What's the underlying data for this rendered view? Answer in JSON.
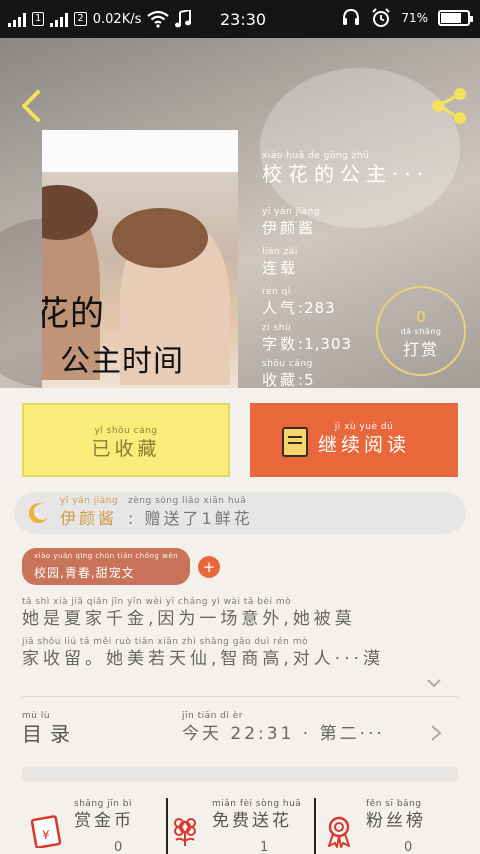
{
  "status_bar": {
    "sim1": "1",
    "sim2": "2",
    "speed": "0.02K/s",
    "time": "23:30",
    "battery": "71%",
    "battery_level": 0.71
  },
  "book": {
    "title_py": "xiào  huā   de  gōng  zhǔ",
    "title": "校花的公主···",
    "author_py": "yī  yán  jiàng",
    "author": "伊颜酱",
    "status_py": "lián  zài",
    "status": "连载",
    "popularity_py": "rén  qì",
    "popularity_label": "人气",
    "popularity_value": ":283",
    "words_py": "zì  shù",
    "words_label": "字数",
    "words_value": ":1,303",
    "favorites_py": "shōu  cáng",
    "favorites_label": "收藏",
    "favorites_value": ":5",
    "cover_title_line1": "校花的",
    "cover_title_line2": "公主时间"
  },
  "tip": {
    "count": "0",
    "label_py": "dǎ  shǎng",
    "label": "打赏"
  },
  "actions": {
    "fav_py": "yǐ   shōu  cáng",
    "fav_label": "已收藏",
    "read_py": "jì    xù    yuè   dú",
    "read_label": "继续阅读"
  },
  "gift": {
    "author_py": "yī  yán  jiàng",
    "author": "伊颜酱",
    "message_py": "zèng sòng  liǎo   xiān  huā",
    "message": ": 赠送了1鲜花"
  },
  "tags": {
    "tag_py": "xiào  yuán   qīng  chūn    tián  chǒng  wén",
    "tag_label": "校园,青春,甜宠文",
    "add": "+"
  },
  "synopsis": {
    "line1_py": "tā   shì  xià  jiā  qiān  jīn     yīn  wèi  yī  cháng  yì  wài    tā  bèi  mò",
    "line1": "她是夏家千金,因为一场意外,她被莫",
    "line2_py": "jiā  shōu  liú      tā  měi  ruò  tiān  xiān   zhì  shāng  gāo    duì  rén    mò",
    "line2": "家收留。她美若天仙,智商高,对人···漠"
  },
  "catalog": {
    "label_py": "mù   lù",
    "label": "目录",
    "latest_py": "jīn  tiān                       dì   èr",
    "latest": "今天 22:31 · 第二···"
  },
  "bottom": {
    "reward_py": "shǎng  jīn   bì",
    "reward_label": "赏金币",
    "reward_count": "0",
    "flower_py": "miǎn  fèi  sòng  huā",
    "flower_label": "免费送花",
    "flower_count": "1",
    "fans_py": "fěn   sī   bǎng",
    "fans_label": "粉丝榜",
    "fans_count": "0"
  },
  "icons": {
    "back": "chevron-left-icon",
    "share": "share-icon",
    "book": "book-icon",
    "moon": "moon-icon",
    "gift": "red-envelope-icon",
    "flower": "flower-icon",
    "ribbon": "ribbon-badge-icon"
  },
  "colors": {
    "accent": "#e8683b",
    "fav_bg": "#f9ec7a",
    "tag_bg": "#c8735a",
    "tip_ring": "#e8d17a"
  }
}
